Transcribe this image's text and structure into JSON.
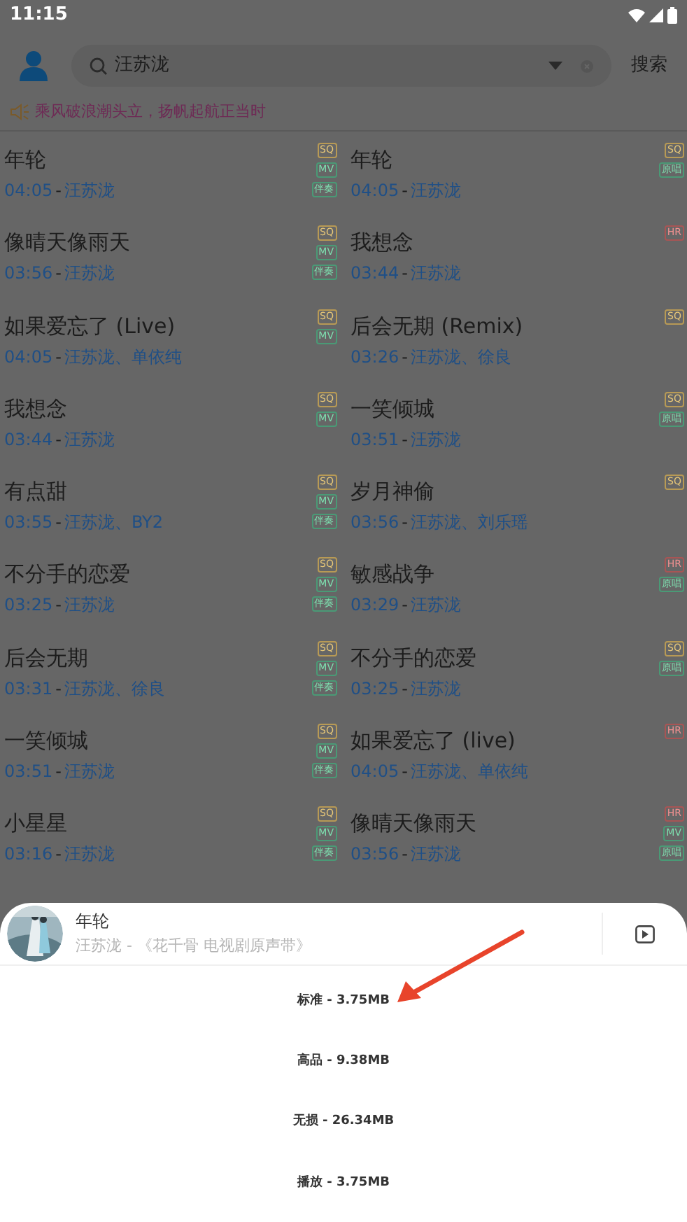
{
  "status_bar": {
    "time": "11:15"
  },
  "search": {
    "value": "汪苏泷",
    "button": "搜索"
  },
  "notice": {
    "text": "乘风破浪潮头立，扬帆起航正当时"
  },
  "columns": [
    {
      "songs": [
        {
          "title": "年轮",
          "duration": "04:05",
          "separator": "-",
          "artist": "汪苏泷",
          "tags": [
            {
              "kind": "sq",
              "text": "SQ"
            },
            {
              "kind": "mv",
              "text": "MV"
            },
            {
              "kind": "extra",
              "text": "伴奏"
            }
          ]
        },
        {
          "title": "像晴天像雨天",
          "duration": "03:56",
          "separator": "-",
          "artist": "汪苏泷",
          "tags": [
            {
              "kind": "sq",
              "text": "SQ"
            },
            {
              "kind": "mv",
              "text": "MV"
            },
            {
              "kind": "extra",
              "text": "伴奏"
            }
          ]
        },
        {
          "title": "如果爱忘了 (Live)",
          "duration": "04:05",
          "separator": "-",
          "artist": "汪苏泷、单依纯",
          "tags": [
            {
              "kind": "sq",
              "text": "SQ"
            },
            {
              "kind": "mv",
              "text": "MV"
            }
          ]
        },
        {
          "title": "我想念",
          "duration": "03:44",
          "separator": "-",
          "artist": "汪苏泷",
          "tags": [
            {
              "kind": "sq",
              "text": "SQ"
            },
            {
              "kind": "mv",
              "text": "MV"
            }
          ]
        },
        {
          "title": "有点甜",
          "duration": "03:55",
          "separator": "-",
          "artist": "汪苏泷、BY2",
          "tags": [
            {
              "kind": "sq",
              "text": "SQ"
            },
            {
              "kind": "mv",
              "text": "MV"
            },
            {
              "kind": "extra",
              "text": "伴奏"
            }
          ]
        },
        {
          "title": "不分手的恋爱",
          "duration": "03:25",
          "separator": "-",
          "artist": "汪苏泷",
          "tags": [
            {
              "kind": "sq",
              "text": "SQ"
            },
            {
              "kind": "mv",
              "text": "MV"
            },
            {
              "kind": "extra",
              "text": "伴奏"
            }
          ]
        },
        {
          "title": "后会无期",
          "duration": "03:31",
          "separator": "-",
          "artist": "汪苏泷、徐良",
          "tags": [
            {
              "kind": "sq",
              "text": "SQ"
            },
            {
              "kind": "mv",
              "text": "MV"
            },
            {
              "kind": "extra",
              "text": "伴奏"
            }
          ]
        },
        {
          "title": "一笑倾城",
          "duration": "03:51",
          "separator": "-",
          "artist": "汪苏泷",
          "tags": [
            {
              "kind": "sq",
              "text": "SQ"
            },
            {
              "kind": "mv",
              "text": "MV"
            },
            {
              "kind": "extra",
              "text": "伴奏"
            }
          ]
        },
        {
          "title": "小星星",
          "duration": "03:16",
          "separator": "-",
          "artist": "汪苏泷",
          "tags": [
            {
              "kind": "sq",
              "text": "SQ"
            },
            {
              "kind": "mv",
              "text": "MV"
            },
            {
              "kind": "extra",
              "text": "伴奏"
            }
          ]
        }
      ]
    },
    {
      "songs": [
        {
          "title": "年轮",
          "duration": "04:05",
          "separator": "-",
          "artist": "汪苏泷",
          "tags": [
            {
              "kind": "sq",
              "text": "SQ"
            },
            {
              "kind": "extra",
              "text": "原唱"
            }
          ]
        },
        {
          "title": "我想念",
          "duration": "03:44",
          "separator": "-",
          "artist": "汪苏泷",
          "tags": [
            {
              "kind": "hr",
              "text": "HR"
            }
          ]
        },
        {
          "title": "后会无期 (Remix)",
          "duration": "03:26",
          "separator": "-",
          "artist": "汪苏泷、徐良",
          "tags": [
            {
              "kind": "sq",
              "text": "SQ"
            }
          ]
        },
        {
          "title": "一笑倾城",
          "duration": "03:51",
          "separator": "-",
          "artist": "汪苏泷",
          "tags": [
            {
              "kind": "sq",
              "text": "SQ"
            },
            {
              "kind": "extra",
              "text": "原唱"
            }
          ]
        },
        {
          "title": "岁月神偷",
          "duration": "03:56",
          "separator": "-",
          "artist": "汪苏泷、刘乐瑶",
          "tags": [
            {
              "kind": "sq",
              "text": "SQ"
            }
          ]
        },
        {
          "title": "敏感战争",
          "duration": "03:29",
          "separator": "-",
          "artist": "汪苏泷",
          "tags": [
            {
              "kind": "hr",
              "text": "HR"
            },
            {
              "kind": "extra",
              "text": "原唱"
            }
          ]
        },
        {
          "title": "不分手的恋爱",
          "duration": "03:25",
          "separator": "-",
          "artist": "汪苏泷",
          "tags": [
            {
              "kind": "sq",
              "text": "SQ"
            },
            {
              "kind": "extra",
              "text": "原唱"
            }
          ]
        },
        {
          "title": "如果爱忘了 (live)",
          "duration": "04:05",
          "separator": "-",
          "artist": "汪苏泷、单依纯",
          "tags": [
            {
              "kind": "hr",
              "text": "HR"
            }
          ]
        },
        {
          "title": "像晴天像雨天",
          "duration": "03:56",
          "separator": "-",
          "artist": "汪苏泷",
          "tags": [
            {
              "kind": "hr",
              "text": "HR"
            },
            {
              "kind": "mv",
              "text": "MV"
            },
            {
              "kind": "extra",
              "text": "原唱"
            }
          ]
        }
      ]
    }
  ],
  "sheet": {
    "title": "年轮",
    "subtitle": "汪苏泷 - 《花千骨 电视剧原声带》",
    "options": [
      {
        "label": "标准 - 3.75MB"
      },
      {
        "label": "高品 - 9.38MB"
      },
      {
        "label": "无损 - 26.34MB"
      },
      {
        "label": "播放 - 3.75MB"
      }
    ]
  }
}
